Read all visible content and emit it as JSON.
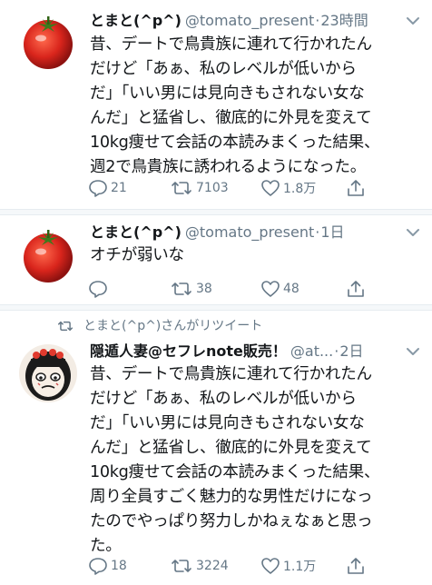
{
  "tweets": [
    {
      "name": "とまと(^p^)",
      "handle": "@tomato_present",
      "time": "23時間",
      "text": "昔、デートで鳥貴族に連れて行かれたん\nだけど「あぁ、私のレベルが低いから\nだ」「いい男には見向きもされない女な\nんだ」と猛省し、徹底的に外見を変えて\n10kg痩せて会話の本読みまくった結果、\n週2で鳥貴族に誘われるようになった。",
      "replies": "21",
      "retweets": "7103",
      "likes": "1.8万"
    },
    {
      "name": "とまと(^p^)",
      "handle": "@tomato_present",
      "time": "1日",
      "text": "オチが弱いな",
      "replies": "",
      "retweets": "38",
      "likes": "48"
    },
    {
      "retweet_note": "とまと(^p^)さんがリツイート",
      "name": "隠遁人妻@セフレnote販売！",
      "handle": "@at...",
      "time": "2日",
      "text": "昔、デートで鳥貴族に連れて行かれたん\nだけど「あぁ、私のレベルが低いから\nだ」「いい男には見向きもされない女な\nんだ」と猛省し、徹底的に外見を変えて\n10kg痩せて会話の本読みまくった結果、\n周り全員すごく魅力的な男性だけになっ\nたのでやっぱり努力しかねぇなぁと思っ\nた。",
      "replies": "18",
      "retweets": "3224",
      "likes": "1.1万"
    }
  ],
  "icons": {
    "reply": "speech-bubble-icon",
    "retweet": "retweet-arrows-icon",
    "like": "heart-icon",
    "share": "share-upload-icon",
    "more": "chevron-down-icon"
  },
  "colors": {
    "text": "#14171a",
    "secondary": "#657786",
    "separator": "#e6ecf0",
    "tomato_red": "#d9251c"
  }
}
